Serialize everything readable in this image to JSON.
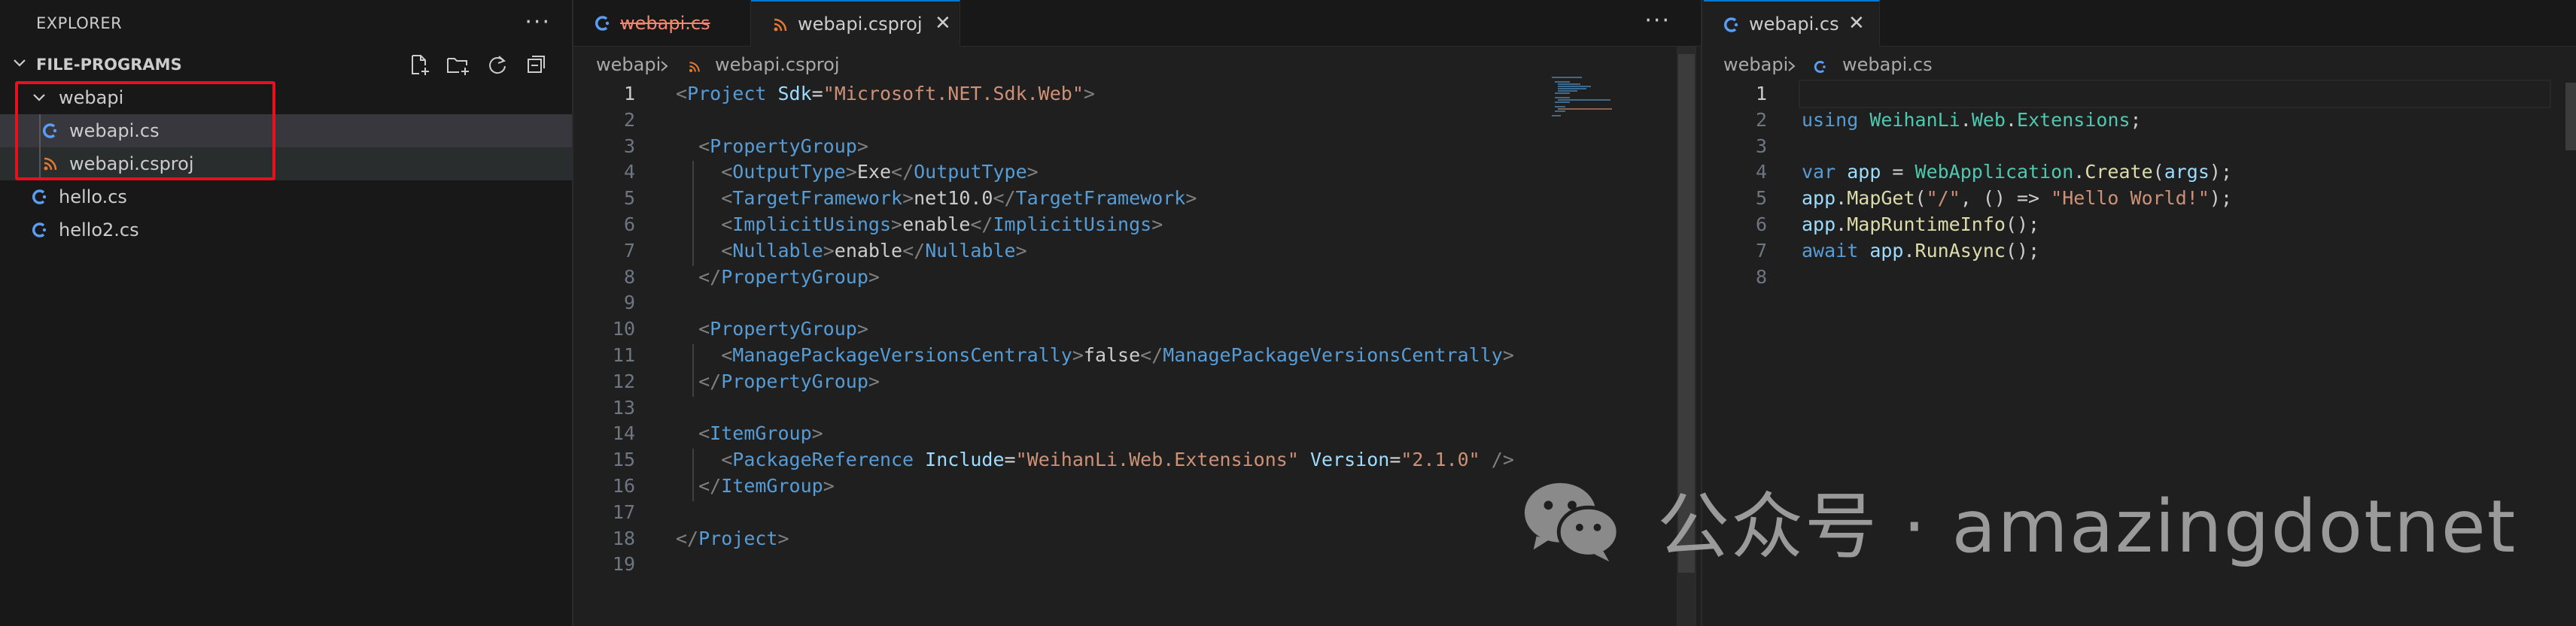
{
  "explorer": {
    "title": "EXPLORER",
    "more": "···",
    "folder_name": "FILE-PROGRAMS",
    "toolbar_icons": [
      "new-file-icon",
      "new-folder-icon",
      "refresh-icon",
      "collapse-all-icon"
    ],
    "items": [
      {
        "label": "webapi",
        "type": "folder"
      },
      {
        "label": "webapi.cs",
        "type": "csharp"
      },
      {
        "label": "webapi.csproj",
        "type": "rss"
      },
      {
        "label": "hello.cs",
        "type": "csharp"
      },
      {
        "label": "hello2.cs",
        "type": "csharp"
      }
    ]
  },
  "editor_left": {
    "tabs": [
      {
        "label": "webapi.cs",
        "icon": "csharp-icon",
        "deleted": true
      },
      {
        "label": "webapi.csproj",
        "icon": "rss-icon",
        "active": true,
        "close": "✕"
      }
    ],
    "more": "···",
    "breadcrumb": [
      "webapi",
      "webapi.csproj"
    ],
    "line_numbers": [
      "1",
      "2",
      "3",
      "4",
      "5",
      "6",
      "7",
      "8",
      "9",
      "10",
      "11",
      "12",
      "13",
      "14",
      "15",
      "16",
      "17",
      "18",
      "19"
    ],
    "lines": [
      "<Project Sdk=\"Microsoft.NET.Sdk.Web\">",
      "",
      "  <PropertyGroup>",
      "    <OutputType>Exe</OutputType>",
      "    <TargetFramework>net10.0</TargetFramework>",
      "    <ImplicitUsings>enable</ImplicitUsings>",
      "    <Nullable>enable</Nullable>",
      "  </PropertyGroup>",
      "",
      "  <PropertyGroup>",
      "    <ManagePackageVersionsCentrally>false</ManagePackageVersionsCentrally>",
      "  </PropertyGroup>",
      "",
      "  <ItemGroup>",
      "    <PackageReference Include=\"WeihanLi.Web.Extensions\" Version=\"2.1.0\" />",
      "  </ItemGroup>",
      "",
      "</Project>",
      ""
    ]
  },
  "editor_right": {
    "tab": {
      "label": "webapi.cs",
      "icon": "csharp-icon",
      "close": "✕"
    },
    "breadcrumb": [
      "webapi",
      "webapi.cs"
    ],
    "line_numbers": [
      "1",
      "2",
      "3",
      "4",
      "5",
      "6",
      "7",
      "8"
    ],
    "lines": [
      "",
      "using WeihanLi.Web.Extensions;",
      "",
      "var app = WebApplication.Create(args);",
      "app.MapGet(\"/\", () => \"Hello World!\");",
      "app.MapRuntimeInfo();",
      "await app.RunAsync();",
      ""
    ]
  },
  "watermark": {
    "text": "公众号 · amazingdotnet",
    "icon": "wechat-icon"
  },
  "colors": {
    "accent": "#0078d4",
    "highlight_box": "#e8101a",
    "csharp_icon": "#589df6",
    "rss_icon": "#e37933",
    "deleted_tab": "#f48771"
  }
}
